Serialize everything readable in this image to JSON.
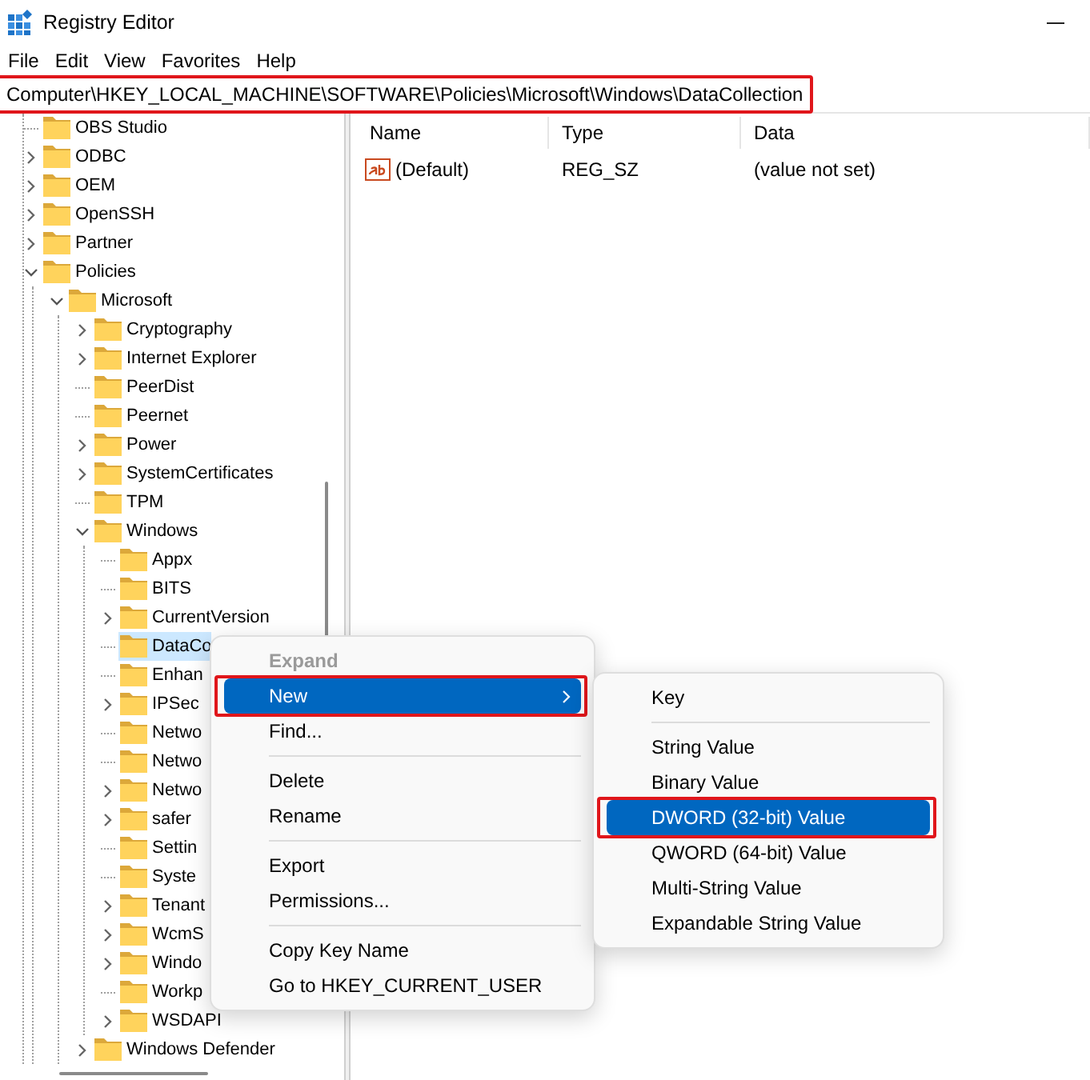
{
  "window": {
    "title": "Registry Editor"
  },
  "menu_bar": [
    "File",
    "Edit",
    "View",
    "Favorites",
    "Help"
  ],
  "address_bar": {
    "value": "Computer\\HKEY_LOCAL_MACHINE\\SOFTWARE\\Policies\\Microsoft\\Windows\\DataCollection",
    "highlighted": true
  },
  "tree": [
    {
      "label": "OBS Studio",
      "expandable": false,
      "selected": false
    },
    {
      "label": "ODBC",
      "expandable": true,
      "expanded": false,
      "selected": false
    },
    {
      "label": "OEM",
      "expandable": true,
      "expanded": false,
      "selected": false
    },
    {
      "label": "OpenSSH",
      "expandable": true,
      "expanded": false,
      "selected": false
    },
    {
      "label": "Partner",
      "expandable": true,
      "expanded": false,
      "selected": false
    },
    {
      "label": "Policies",
      "expandable": true,
      "expanded": true,
      "selected": false,
      "children": [
        {
          "label": "Microsoft",
          "expandable": true,
          "expanded": true,
          "selected": false,
          "children": [
            {
              "label": "Cryptography",
              "expandable": true,
              "expanded": false,
              "selected": false
            },
            {
              "label": "Internet Explorer",
              "expandable": true,
              "expanded": false,
              "selected": false
            },
            {
              "label": "PeerDist",
              "expandable": false,
              "selected": false
            },
            {
              "label": "Peernet",
              "expandable": false,
              "selected": false
            },
            {
              "label": "Power",
              "expandable": true,
              "expanded": false,
              "selected": false
            },
            {
              "label": "SystemCertificates",
              "expandable": true,
              "expanded": false,
              "selected": false
            },
            {
              "label": "TPM",
              "expandable": false,
              "selected": false
            },
            {
              "label": "Windows",
              "expandable": true,
              "expanded": true,
              "selected": false,
              "children": [
                {
                  "label": "Appx",
                  "expandable": false,
                  "selected": false
                },
                {
                  "label": "BITS",
                  "expandable": false,
                  "selected": false
                },
                {
                  "label": "CurrentVersion",
                  "expandable": true,
                  "expanded": false,
                  "selected": false
                },
                {
                  "label": "DataCo",
                  "expandable": false,
                  "selected": true
                },
                {
                  "label": "Enhan",
                  "expandable": false,
                  "selected": false
                },
                {
                  "label": "IPSec",
                  "expandable": true,
                  "expanded": false,
                  "selected": false
                },
                {
                  "label": "Netwo",
                  "expandable": false,
                  "selected": false
                },
                {
                  "label": "Netwo",
                  "expandable": false,
                  "selected": false
                },
                {
                  "label": "Netwo",
                  "expandable": true,
                  "expanded": false,
                  "selected": false
                },
                {
                  "label": "safer",
                  "expandable": true,
                  "expanded": false,
                  "selected": false
                },
                {
                  "label": "Settin",
                  "expandable": false,
                  "selected": false
                },
                {
                  "label": "Syste",
                  "expandable": false,
                  "selected": false
                },
                {
                  "label": "Tenant",
                  "expandable": true,
                  "expanded": false,
                  "selected": false
                },
                {
                  "label": "WcmS",
                  "expandable": true,
                  "expanded": false,
                  "selected": false
                },
                {
                  "label": "Windo",
                  "expandable": true,
                  "expanded": false,
                  "selected": false
                },
                {
                  "label": "Workp",
                  "expandable": false,
                  "selected": false
                },
                {
                  "label": "WSDAPI",
                  "expandable": true,
                  "expanded": false,
                  "selected": false
                }
              ]
            },
            {
              "label": "Windows Defender",
              "expandable": true,
              "expanded": false,
              "selected": false
            }
          ]
        }
      ]
    }
  ],
  "columns": [
    "Name",
    "Type",
    "Data"
  ],
  "values": [
    {
      "name": "(Default)",
      "type": "REG_SZ",
      "data": "(value not set)"
    }
  ],
  "context_menu": [
    {
      "kind": "item",
      "label": "Expand",
      "disabled": true,
      "selected": false,
      "highlighted": false,
      "submenu": false
    },
    {
      "kind": "item",
      "label": "New",
      "disabled": false,
      "selected": true,
      "highlighted": true,
      "submenu": true
    },
    {
      "kind": "item",
      "label": "Find...",
      "disabled": false,
      "selected": false,
      "highlighted": false,
      "submenu": false
    },
    {
      "kind": "separator"
    },
    {
      "kind": "item",
      "label": "Delete",
      "disabled": false,
      "selected": false,
      "highlighted": false,
      "submenu": false
    },
    {
      "kind": "item",
      "label": "Rename",
      "disabled": false,
      "selected": false,
      "highlighted": false,
      "submenu": false
    },
    {
      "kind": "separator"
    },
    {
      "kind": "item",
      "label": "Export",
      "disabled": false,
      "selected": false,
      "highlighted": false,
      "submenu": false
    },
    {
      "kind": "item",
      "label": "Permissions...",
      "disabled": false,
      "selected": false,
      "highlighted": false,
      "submenu": false
    },
    {
      "kind": "separator"
    },
    {
      "kind": "item",
      "label": "Copy Key Name",
      "disabled": false,
      "selected": false,
      "highlighted": false,
      "submenu": false
    },
    {
      "kind": "item",
      "label": "Go to HKEY_CURRENT_USER",
      "disabled": false,
      "selected": false,
      "highlighted": false,
      "submenu": false
    }
  ],
  "submenu": [
    {
      "kind": "item",
      "label": "Key",
      "disabled": false,
      "selected": false,
      "highlighted": false,
      "submenu": false
    },
    {
      "kind": "separator"
    },
    {
      "kind": "item",
      "label": "String Value",
      "disabled": false,
      "selected": false,
      "highlighted": false,
      "submenu": false
    },
    {
      "kind": "item",
      "label": "Binary Value",
      "disabled": false,
      "selected": false,
      "highlighted": false,
      "submenu": false
    },
    {
      "kind": "item",
      "label": "DWORD (32-bit) Value",
      "disabled": false,
      "selected": true,
      "highlighted": true,
      "submenu": false
    },
    {
      "kind": "item",
      "label": "QWORD (64-bit) Value",
      "disabled": false,
      "selected": false,
      "highlighted": false,
      "submenu": false
    },
    {
      "kind": "item",
      "label": "Multi-String Value",
      "disabled": false,
      "selected": false,
      "highlighted": false,
      "submenu": false
    },
    {
      "kind": "item",
      "label": "Expandable String Value",
      "disabled": false,
      "selected": false,
      "highlighted": false,
      "submenu": false
    }
  ]
}
